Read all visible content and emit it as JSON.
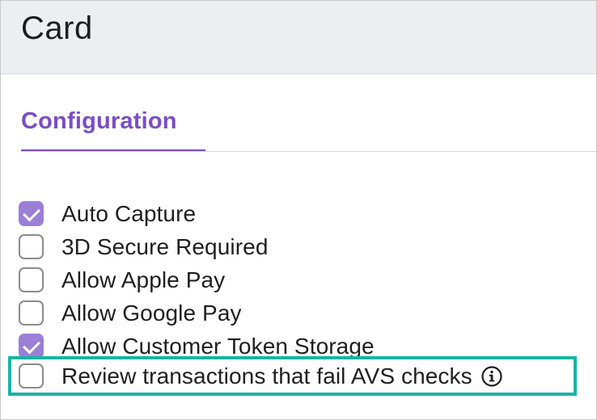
{
  "panel": {
    "title": "Card"
  },
  "tabs": [
    {
      "label": "Configuration",
      "active": true
    }
  ],
  "options": [
    {
      "label": "Auto Capture",
      "checked": true
    },
    {
      "label": "3D Secure Required",
      "checked": false
    },
    {
      "label": "Allow Apple Pay",
      "checked": false
    },
    {
      "label": "Allow Google Pay",
      "checked": false
    },
    {
      "label": "Allow Customer Token Storage",
      "checked": true
    }
  ],
  "avs_option": {
    "label": "Review transactions that fail AVS checks",
    "checked": false,
    "icon": "info-icon"
  },
  "colors": {
    "accent": "#7a4dc6",
    "checked_fill": "#9b7fd6",
    "header_bg": "#eceef2",
    "highlight": "#19b3a5"
  }
}
